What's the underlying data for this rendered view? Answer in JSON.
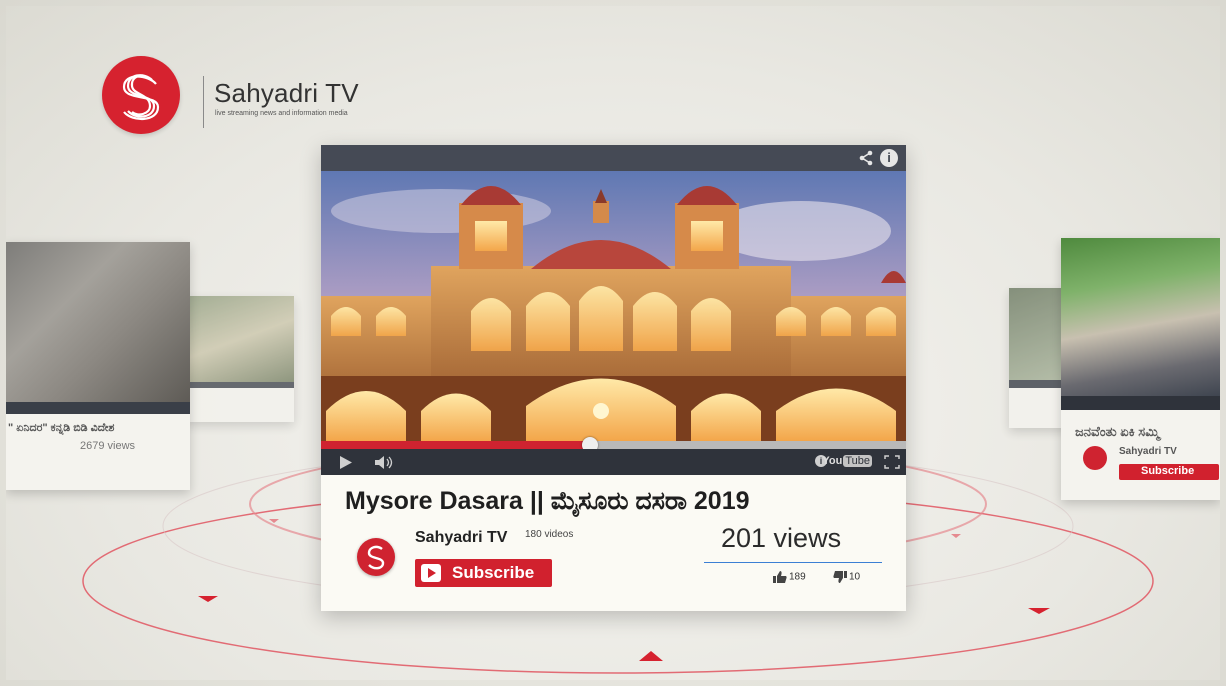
{
  "brand": {
    "name": "Sahyadri TV",
    "tagline": "live streaming news and information media",
    "color": "#d6222f"
  },
  "main_card": {
    "title": "Mysore Dasara || ಮೈಸೂರು ದಸರಾ 2019",
    "channel": "Sahyadri TV",
    "video_count": "180 videos",
    "subscribe_label": "Subscribe",
    "views": "201 views",
    "likes": "189",
    "dislikes": "10",
    "progress": 0.46,
    "player_logo": "You",
    "player_logo_tube": "Tube",
    "icons": [
      "share-icon",
      "info-icon",
      "play-icon",
      "volume-icon",
      "youtube-logo",
      "fullscreen-icon"
    ]
  },
  "left_card": {
    "title": "\" ಏನಿದರ\" ಕನ್ನಡಿ ಬಿಡಿ ವಿದೇಶ",
    "views": "2679 views"
  },
  "right_card": {
    "title": "ಜನವೆಂತು ಏಕಿ ಸಮ್ಮಿ",
    "channel": "Sahyadri TV",
    "subscribe_label": "Subscribe"
  }
}
